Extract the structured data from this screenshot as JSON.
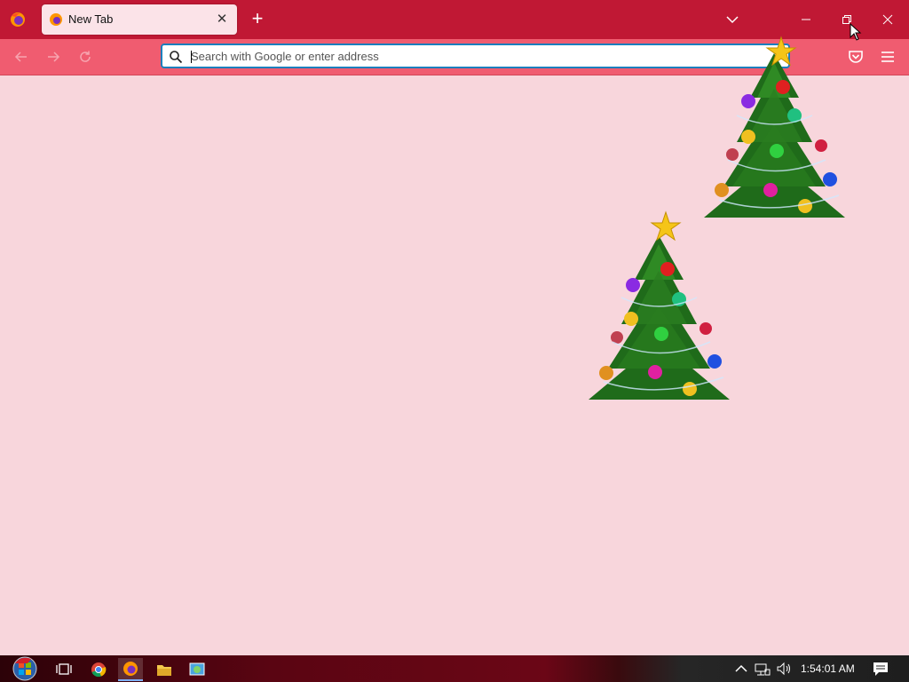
{
  "browser": {
    "active_tab": {
      "title": "New Tab",
      "close_symbol": "✕"
    },
    "new_tab_symbol": "+",
    "urlbar": {
      "placeholder": "Search with Google or enter address",
      "value": ""
    }
  },
  "colors": {
    "tabbar": "#c01834",
    "toolbar": "#f05c70",
    "page_background": "#f8d6dc",
    "urlbar_focus": "#1b7fbd"
  },
  "icons": {
    "app": "firefox-icon",
    "back": "back-arrow-icon",
    "forward": "forward-arrow-icon",
    "reload": "reload-icon",
    "search": "search-icon",
    "pocket": "pocket-icon",
    "menu": "hamburger-menu-icon",
    "tab_list": "chevron-down-icon",
    "minimize": "minimize-icon",
    "restore": "restore-icon",
    "close": "close-icon"
  },
  "decorations": [
    "christmas-tree-top-right",
    "christmas-tree-center-right"
  ],
  "taskbar": {
    "apps": [
      "start-button",
      "task-view",
      "chrome",
      "firefox",
      "file-explorer",
      "control-panel"
    ],
    "active_app": "firefox",
    "tray_icons": [
      "show-hidden-icons",
      "network",
      "volume"
    ],
    "clock": "1:54:01 AM"
  }
}
